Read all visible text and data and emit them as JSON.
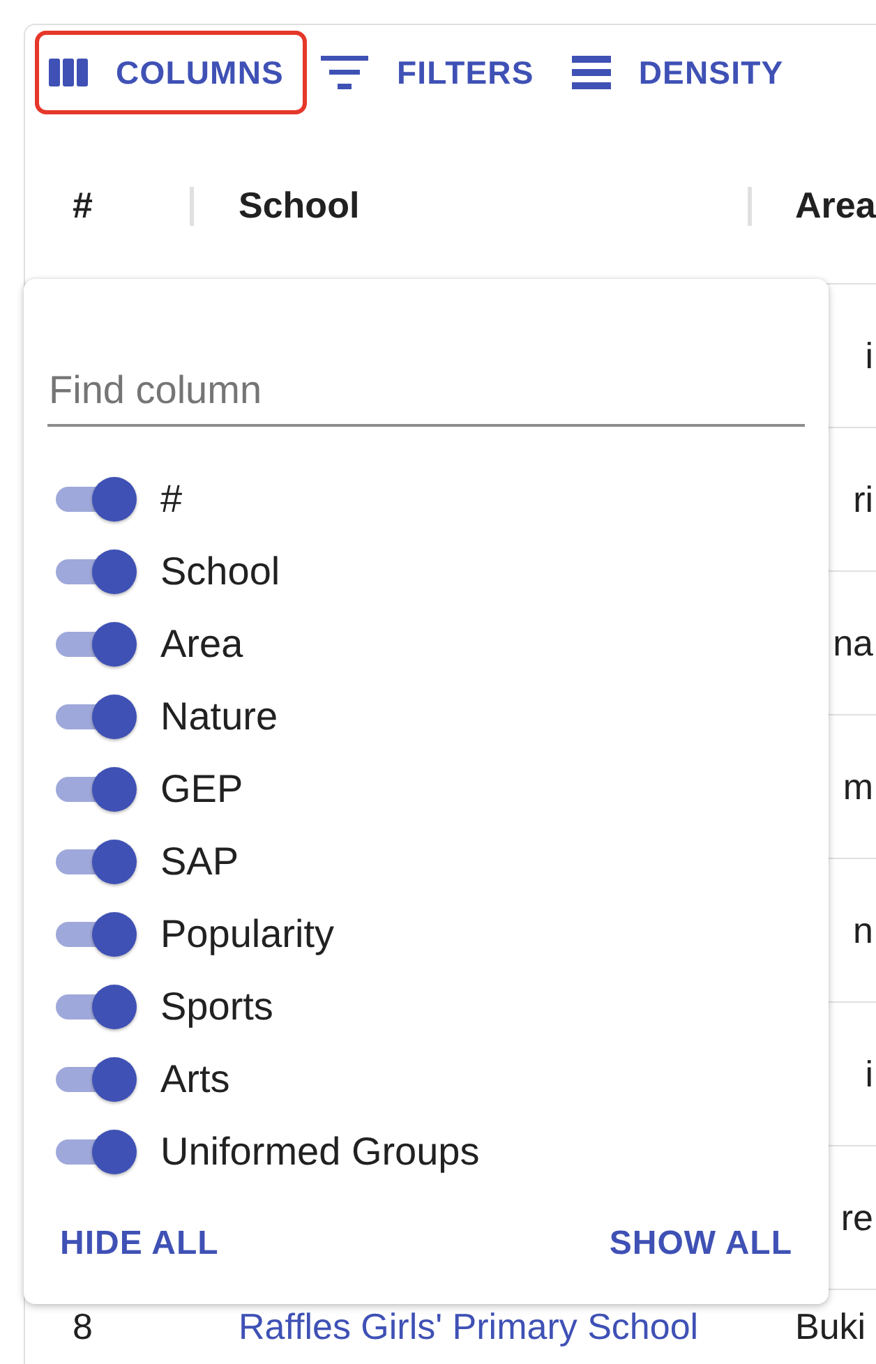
{
  "toolbar": {
    "buttons": [
      {
        "kind": "columns",
        "label": "COLUMNS",
        "highlighted": true
      },
      {
        "kind": "filters",
        "label": "FILTERS",
        "highlighted": false
      },
      {
        "kind": "density",
        "label": "DENSITY",
        "highlighted": false
      }
    ]
  },
  "table": {
    "columns": [
      "#",
      "School",
      "Area"
    ],
    "rows": [
      {
        "kind": "covered",
        "area": "i"
      },
      {
        "kind": "covered",
        "area": "ri"
      },
      {
        "kind": "covered",
        "area": "na"
      },
      {
        "kind": "covered",
        "area": "m"
      },
      {
        "kind": "covered",
        "area": "n"
      },
      {
        "kind": "covered",
        "area": "i"
      },
      {
        "kind": "covered",
        "area": "re"
      },
      {
        "kind": "full",
        "number": "8",
        "school": "Raffles Girls' Primary School",
        "area": "Buki"
      }
    ]
  },
  "columns_panel": {
    "search": {
      "placeholder": "Find column"
    },
    "items": [
      {
        "label": "#",
        "checked": true
      },
      {
        "label": "School",
        "checked": true
      },
      {
        "label": "Area",
        "checked": true
      },
      {
        "label": "Nature",
        "checked": true
      },
      {
        "label": "GEP",
        "checked": true
      },
      {
        "label": "SAP",
        "checked": true
      },
      {
        "label": "Popularity",
        "checked": true
      },
      {
        "label": "Sports",
        "checked": true
      },
      {
        "label": "Arts",
        "checked": true
      },
      {
        "label": "Uniformed Groups",
        "checked": true
      }
    ],
    "actions": [
      {
        "kind": "hide_all",
        "label": "HIDE ALL"
      },
      {
        "kind": "show_all",
        "label": "SHOW ALL"
      }
    ]
  }
}
